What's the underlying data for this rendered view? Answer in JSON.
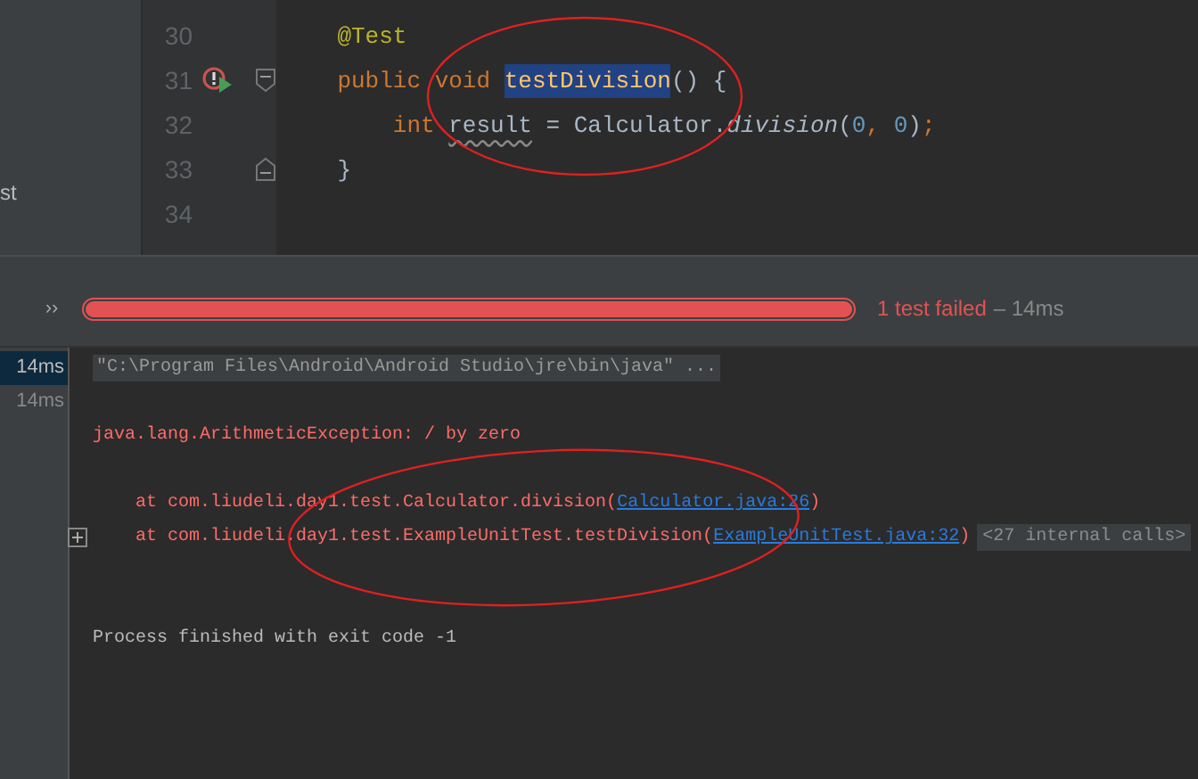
{
  "project_panel": {
    "label": "st"
  },
  "editor": {
    "lines": [
      {
        "number": "30",
        "tokens": [
          {
            "text": "    @Test",
            "kind": "annotation"
          }
        ]
      },
      {
        "number": "31",
        "gutter_icons": [
          {
            "kind": "failed_test"
          },
          {
            "kind": "fold_start"
          }
        ],
        "tokens": [
          {
            "text": "    public ",
            "kind": "keyword"
          },
          {
            "text": "void ",
            "kind": "keyword"
          },
          {
            "text": "testDivision",
            "kind": "selected"
          },
          {
            "text": "() {",
            "kind": "plain"
          }
        ]
      },
      {
        "number": "32",
        "tokens": [
          {
            "text": "        int ",
            "kind": "keyword"
          },
          {
            "text": "result",
            "kind": "unused"
          },
          {
            "text": " = Calculator.",
            "kind": "plain"
          },
          {
            "text": "division",
            "kind": "static"
          },
          {
            "text": "(",
            "kind": "plain"
          },
          {
            "text": "0",
            "kind": "number"
          },
          {
            "text": ", ",
            "kind": "keyword"
          },
          {
            "text": "0",
            "kind": "number"
          },
          {
            "text": ")",
            "kind": "plain"
          },
          {
            "text": ";",
            "kind": "keyword"
          }
        ]
      },
      {
        "number": "33",
        "gutter_icons": [
          {
            "kind": "fold_end"
          }
        ],
        "tokens": [
          {
            "text": "    }",
            "kind": "plain"
          }
        ]
      },
      {
        "number": "34"
      }
    ]
  },
  "runner": {
    "toggle": "››",
    "progress": {
      "level": 1,
      "failed": true
    },
    "status": "1 test failed",
    "duration": "– 14ms",
    "tests": [
      {
        "label": "14ms",
        "selected": true
      },
      {
        "label": "14ms",
        "selected": false
      }
    ],
    "console": [
      {
        "kind": "command",
        "text": "\"C:\\Program Files\\Android\\Android Studio\\jre\\bin\\java\" ..."
      },
      {
        "kind": "blank"
      },
      {
        "kind": "error",
        "text": "java.lang.ArithmeticException: / by zero"
      },
      {
        "kind": "blank"
      },
      {
        "kind": "stack",
        "text": "    at com.liudeli.day1.test.Calculator.division(",
        "link": "Calculator.java:26",
        "close": ")"
      },
      {
        "kind": "stack_collapsible",
        "text": "    at com.liudeli.day1.test.ExampleUnitTest.testDivision(",
        "link": "ExampleUnitTest.java:32",
        "close": ")",
        "folded": "<27 internal calls>"
      },
      {
        "kind": "blank"
      },
      {
        "kind": "blank"
      },
      {
        "kind": "info",
        "text": "Process finished with exit code -1"
      }
    ]
  }
}
